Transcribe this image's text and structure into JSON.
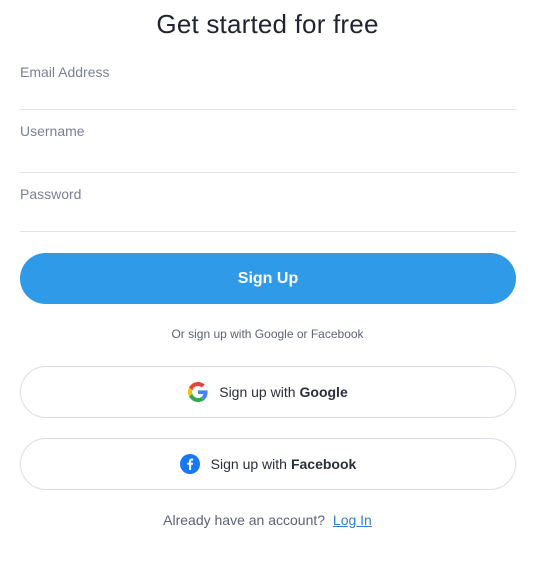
{
  "title": "Get started for free",
  "form": {
    "email_placeholder": "Email Address",
    "username_placeholder": "Username",
    "password_placeholder": "Password",
    "signup_label": "Sign Up"
  },
  "divider_text": "Or sign up with Google or Facebook",
  "social": {
    "google": {
      "prefix": "Sign up with",
      "brand": "Google",
      "icon": "google-icon"
    },
    "facebook": {
      "prefix": "Sign up with",
      "brand": "Facebook",
      "icon": "facebook-icon"
    }
  },
  "footer": {
    "question": "Already have an account?",
    "login_label": "Log In"
  },
  "colors": {
    "primary": "#2f9ae8",
    "link": "#2f7fd6",
    "facebook": "#1877f2"
  }
}
